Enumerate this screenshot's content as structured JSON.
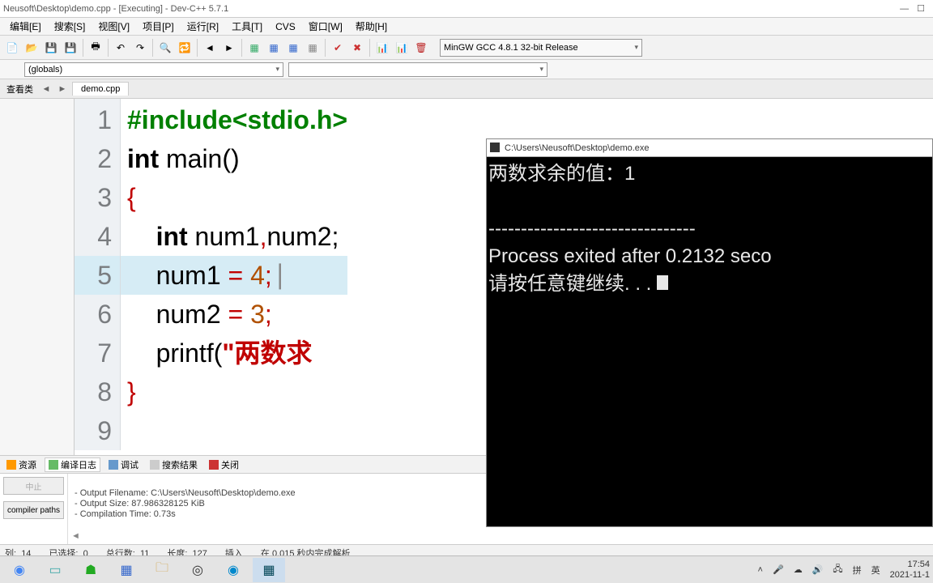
{
  "title": "Neusoft\\Desktop\\demo.cpp - [Executing] - Dev-C++ 5.7.1",
  "menu": [
    "编辑[E]",
    "搜索[S]",
    "视图[V]",
    "项目[P]",
    "运行[R]",
    "工具[T]",
    "CVS",
    "窗口[W]",
    "帮助[H]"
  ],
  "compiler_selector": "MinGW GCC 4.8.1 32-bit Release",
  "globals_text": "(globals)",
  "left_tabs_label": "查看类",
  "file_tab": "demo.cpp",
  "line_numbers": [
    "1",
    "2",
    "3",
    "4",
    "5",
    "6",
    "7",
    "8",
    "9"
  ],
  "code": {
    "l1_pp": "#include",
    "l1_hdr": "<stdio.h>",
    "l2_a": "int",
    "l2_b": " main()",
    "l3": "{",
    "l4_a": "    int",
    "l4_b": " num1",
    "l4_c": ",",
    "l4_d": "num2;",
    "l5_a": "    num1 ",
    "l5_b": "=",
    "l5_c": " 4",
    "l5_d": ";",
    "l6_a": "    num2 ",
    "l6_b": "=",
    "l6_c": " 3",
    "l6_d": ";",
    "l7_a": "    printf(",
    "l7_b": "\"两数求",
    "l8": "}"
  },
  "console_title": "C:\\Users\\Neusoft\\Desktop\\demo.exe",
  "console_lines": [
    "两数求余的值：1",
    "",
    "--------------------------------",
    "Process exited after 0.2132 seco",
    "请按任意键继续. . . "
  ],
  "bottom_tabs": [
    "资源",
    "编译日志",
    "调试",
    "搜索结果",
    "关闭"
  ],
  "output_lines": [
    "- Output Filename: C:\\Users\\Neusoft\\Desktop\\demo.exe",
    "- Output Size: 87.986328125 KiB",
    "- Compilation Time: 0.73s"
  ],
  "compiler_paths_btn": "compiler paths",
  "status": {
    "col_lbl": "列:",
    "col_val": "14",
    "sel_lbl": "已选择:",
    "sel_val": "0",
    "total_lbl": "总行数:",
    "total_val": "11",
    "len_lbl": "长度:",
    "len_val": "127",
    "mode": "插入",
    "parse": "在 0.015 秒内完成解析"
  },
  "tray": {
    "time": "17:54",
    "date": "2021-11-1",
    "ime1": "拼",
    "ime2": "英"
  }
}
